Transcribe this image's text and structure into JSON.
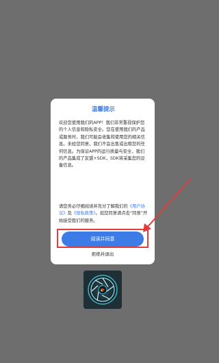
{
  "dialog": {
    "title": "温馨提示",
    "body_intro": "欢迎您使用我们的APP！我们非常重视保护您的个人信息和隐私安全。您在使用我们的产品或服务时，我们可能会收集和使用您的相关信息。未经您同意，我们不会出售或出租您的任何信息。为保证APP的运行质量与安全，我们的产品集成了友盟+SDK，SDK将采集您的设备信息。",
    "body_notice_prefix": "请您务必仔细阅读并充分了解我们的",
    "link_user_agreement": "《用户协议》",
    "conjunction": "及",
    "link_privacy_policy": "《隐私政策》",
    "body_notice_suffix": "。如您同意请点击“同意”开始接受我们的服务。",
    "agree_label": "阅读并同意",
    "refuse_label": "拒绝并退出"
  },
  "colors": {
    "overlay": "#6e6e6e",
    "accent": "#3d7be6",
    "highlight": "#e23b3b"
  },
  "icons": {
    "app_logo": "camera-aperture-icon"
  }
}
